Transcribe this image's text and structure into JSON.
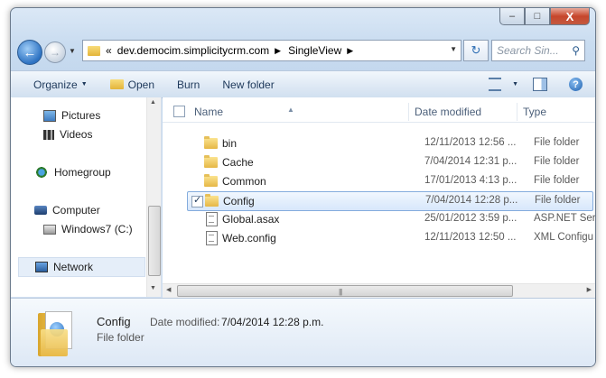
{
  "window": {
    "controls": {
      "minimize": "–",
      "maximize": "□",
      "close": "X"
    }
  },
  "navbar": {
    "back_icon": "back-arrow-icon",
    "forward_icon": "forward-arrow-icon",
    "breadcrumb": [
      "«",
      "dev.democim.simplicitycrm.com",
      "SingleView"
    ],
    "search_placeholder": "Search Sin..."
  },
  "toolbar": {
    "organize": "Organize",
    "open": "Open",
    "burn": "Burn",
    "new_folder": "New folder"
  },
  "sidebar": {
    "items": [
      {
        "label": "Pictures",
        "icon": "pictures-icon"
      },
      {
        "label": "Videos",
        "icon": "videos-icon"
      },
      {
        "label": "Homegroup",
        "icon": "homegroup-icon"
      },
      {
        "label": "Computer",
        "icon": "computer-icon"
      },
      {
        "label": "Windows7 (C:)",
        "icon": "drive-icon"
      },
      {
        "label": "Network",
        "icon": "network-icon"
      }
    ]
  },
  "columns": {
    "name": "Name",
    "date": "Date modified",
    "type": "Type"
  },
  "files": [
    {
      "name": "bin",
      "date": "12/11/2013 12:56 ...",
      "type": "File folder",
      "kind": "folder"
    },
    {
      "name": "Cache",
      "date": "7/04/2014 12:31 p...",
      "type": "File folder",
      "kind": "folder"
    },
    {
      "name": "Common",
      "date": "17/01/2013 4:13 p...",
      "type": "File folder",
      "kind": "folder"
    },
    {
      "name": "Config",
      "date": "7/04/2014 12:28 p...",
      "type": "File folder",
      "kind": "folder",
      "selected": true
    },
    {
      "name": "Global.asax",
      "date": "25/01/2012 3:59 p...",
      "type": "ASP.NET Serv",
      "kind": "file"
    },
    {
      "name": "Web.config",
      "date": "12/11/2013 12:50 ...",
      "type": "XML Configu",
      "kind": "file"
    }
  ],
  "details": {
    "name": "Config",
    "type": "File folder",
    "date_label": "Date modified:",
    "date_value": "7/04/2014 12:28 p.m."
  }
}
